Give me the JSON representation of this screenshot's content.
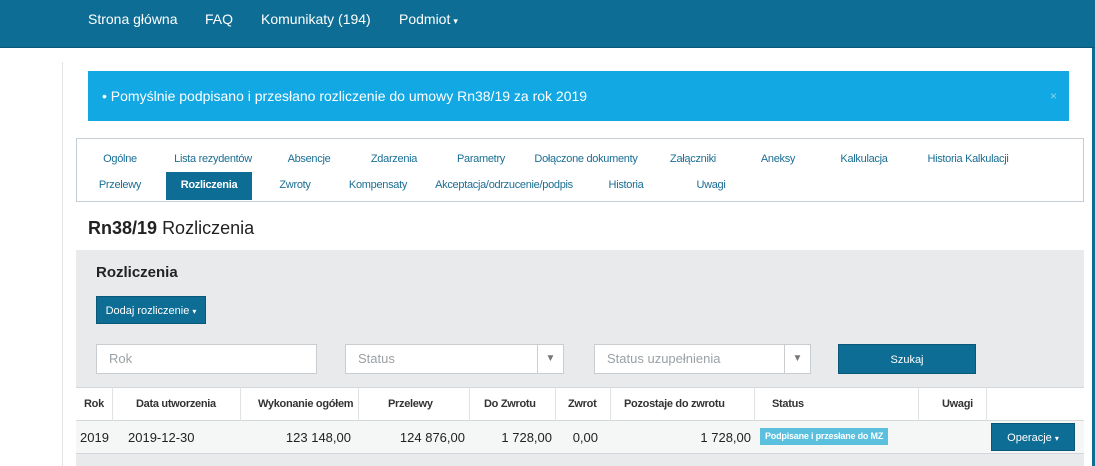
{
  "nav": {
    "items": [
      "Strona główna",
      "FAQ",
      "Komunikaty (194)",
      "Podmiot"
    ],
    "dropdown_caret": "▾"
  },
  "alert": {
    "message": "• Pomyślnie podpisano i przesłano rozliczenie do umowy Rn38/19 za rok 2019",
    "close": "×"
  },
  "tabs": {
    "row1": [
      "Ogólne",
      "Lista rezydentów",
      "Absencje",
      "Zdarzenia",
      "Parametry",
      "Dołączone dokumenty",
      "Załączniki",
      "Aneksy",
      "Kalkulacja",
      "Historia Kalkulacji"
    ],
    "row2": [
      "Przelewy",
      "Rozliczenia",
      "Zwroty",
      "Kompensaty",
      "Akceptacja/odrzucenie/podpis",
      "Historia",
      "Uwagi"
    ],
    "active": "Rozliczenia"
  },
  "page": {
    "contract": "Rn38/19",
    "title": "Rozliczenia"
  },
  "panel": {
    "title": "Rozliczenia",
    "add_button": "Dodaj rozliczenie",
    "add_caret": "▾"
  },
  "filters": {
    "year_placeholder": "Rok",
    "status_placeholder": "Status",
    "completion_placeholder": "Status uzupełnienia",
    "search_button": "Szukaj"
  },
  "table": {
    "headers": [
      "Rok",
      "Data utworzenia",
      "Wykonanie ogółem",
      "Przelewy",
      "Do Zwrotu",
      "Zwrot",
      "Pozostaje do zwrotu",
      "Status",
      "Uwagi"
    ],
    "rows": [
      {
        "rok": "2019",
        "data": "2019-12-30",
        "wykonanie": "123 148,00",
        "przelewy": "124 876,00",
        "do_zwrotu": "1 728,00",
        "zwrot": "0,00",
        "pozostaje": "1 728,00",
        "status": "Podpisane i przesłane do MZ",
        "uwagi": "",
        "operations": "Operacje"
      }
    ]
  },
  "colors": {
    "primary": "#0e6d94",
    "alert": "#11a8e4",
    "badge": "#5bc0de",
    "panel": "#e9eaeb"
  }
}
